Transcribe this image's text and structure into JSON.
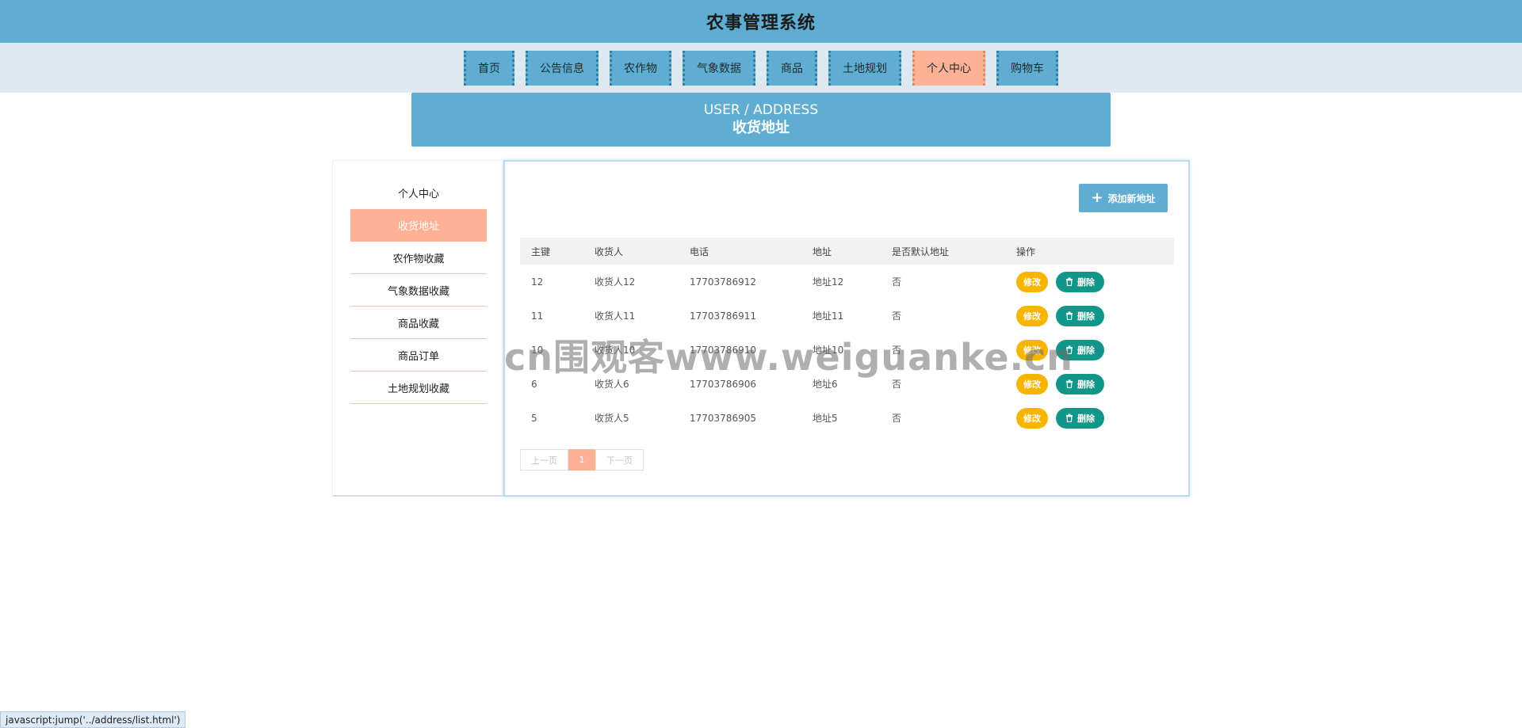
{
  "app": {
    "title": "农事管理系统"
  },
  "nav": {
    "items": [
      {
        "label": "首页"
      },
      {
        "label": "公告信息"
      },
      {
        "label": "农作物"
      },
      {
        "label": "气象数据"
      },
      {
        "label": "商品"
      },
      {
        "label": "土地规划"
      },
      {
        "label": "个人中心",
        "active": true
      },
      {
        "label": "购物车"
      }
    ]
  },
  "banner": {
    "subtitle_en": "USER / ADDRESS",
    "title_cn": "收货地址"
  },
  "sidebar": {
    "items": [
      {
        "label": "个人中心"
      },
      {
        "label": "收货地址",
        "active": true
      },
      {
        "label": "农作物收藏"
      },
      {
        "label": "气象数据收藏"
      },
      {
        "label": "商品收藏"
      },
      {
        "label": "商品订单"
      },
      {
        "label": "土地规划收藏"
      }
    ]
  },
  "toolbar": {
    "add_label": "添加新地址",
    "add_icon": "plus-icon"
  },
  "table": {
    "headers": [
      "主键",
      "收货人",
      "电话",
      "地址",
      "是否默认地址",
      "操作"
    ],
    "edit_label": "修改",
    "delete_label": "删除",
    "delete_icon": "trash-icon",
    "rows": [
      {
        "id": "12",
        "name": "收货人12",
        "phone": "17703786912",
        "address": "地址12",
        "default": "否"
      },
      {
        "id": "11",
        "name": "收货人11",
        "phone": "17703786911",
        "address": "地址11",
        "default": "否"
      },
      {
        "id": "10",
        "name": "收货人10",
        "phone": "17703786910",
        "address": "地址10",
        "default": "否"
      },
      {
        "id": "6",
        "name": "收货人6",
        "phone": "17703786906",
        "address": "地址6",
        "default": "否"
      },
      {
        "id": "5",
        "name": "收货人5",
        "phone": "17703786905",
        "address": "地址5",
        "default": "否"
      }
    ]
  },
  "pagination": {
    "prev_label": "上一页",
    "current_page": "1",
    "next_label": "下一页"
  },
  "watermark": "cn围观客www.weiguanke.cn",
  "status_bar": "javascript:jump('../address/list.html')",
  "colors": {
    "primary": "#5fadd0",
    "accent": "#ffb195",
    "edit": "#f7b500",
    "delete": "#13968a"
  }
}
